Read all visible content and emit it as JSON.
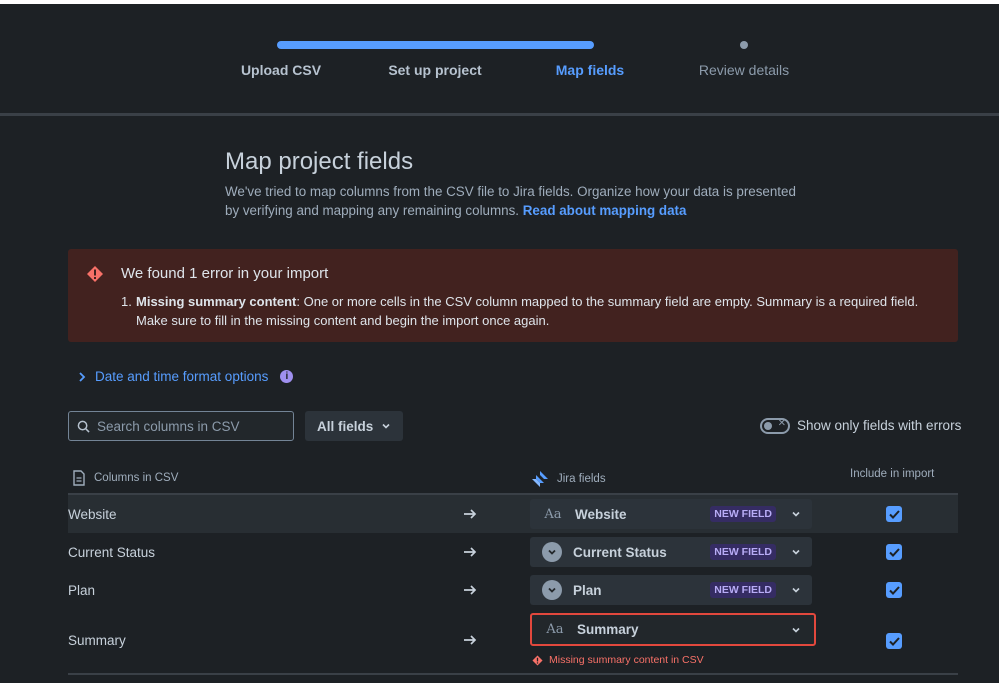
{
  "stepper": {
    "steps": [
      {
        "label": "Upload CSV",
        "state": "done"
      },
      {
        "label": "Set up project",
        "state": "done"
      },
      {
        "label": "Map fields",
        "state": "active"
      },
      {
        "label": "Review details",
        "state": "pending"
      }
    ]
  },
  "header": {
    "title": "Map project fields",
    "description": "We've tried to map columns from the CSV file to Jira fields. Organize how your data is presented by verifying and mapping any remaining columns.",
    "link_label": "Read about mapping data"
  },
  "error_panel": {
    "title": "We found 1 error in your import",
    "number": "1.",
    "bold": "Missing summary content",
    "text": ": One or more cells in the CSV column mapped to the summary field are empty. Summary is a required field.",
    "text2": "Make sure to fill in the missing content and begin the import once again."
  },
  "date_options": {
    "label": "Date and time format options"
  },
  "search": {
    "placeholder": "Search columns in CSV",
    "value": ""
  },
  "filter": {
    "label": "All fields"
  },
  "toggle": {
    "label": "Show only fields with errors",
    "on": false
  },
  "columns": {
    "csv": "Columns in CSV",
    "jira": "Jira fields",
    "include": "Include in import"
  },
  "rows": [
    {
      "csv": "Website",
      "field": "Website",
      "type_icon": "text-icon",
      "badge": "NEW FIELD",
      "included": true
    },
    {
      "csv": "Current Status",
      "field": "Current Status",
      "type_icon": "select-icon",
      "badge": "NEW FIELD",
      "included": true
    },
    {
      "csv": "Plan",
      "field": "Plan",
      "type_icon": "select-icon",
      "badge": "NEW FIELD",
      "included": true
    },
    {
      "csv": "Summary",
      "field": "Summary",
      "type_icon": "text-icon",
      "badge": "",
      "included": true,
      "error": "Missing summary content in CSV"
    }
  ],
  "colors": {
    "accent": "#579dff",
    "error": "#e2483d",
    "background": "#1d2125"
  }
}
